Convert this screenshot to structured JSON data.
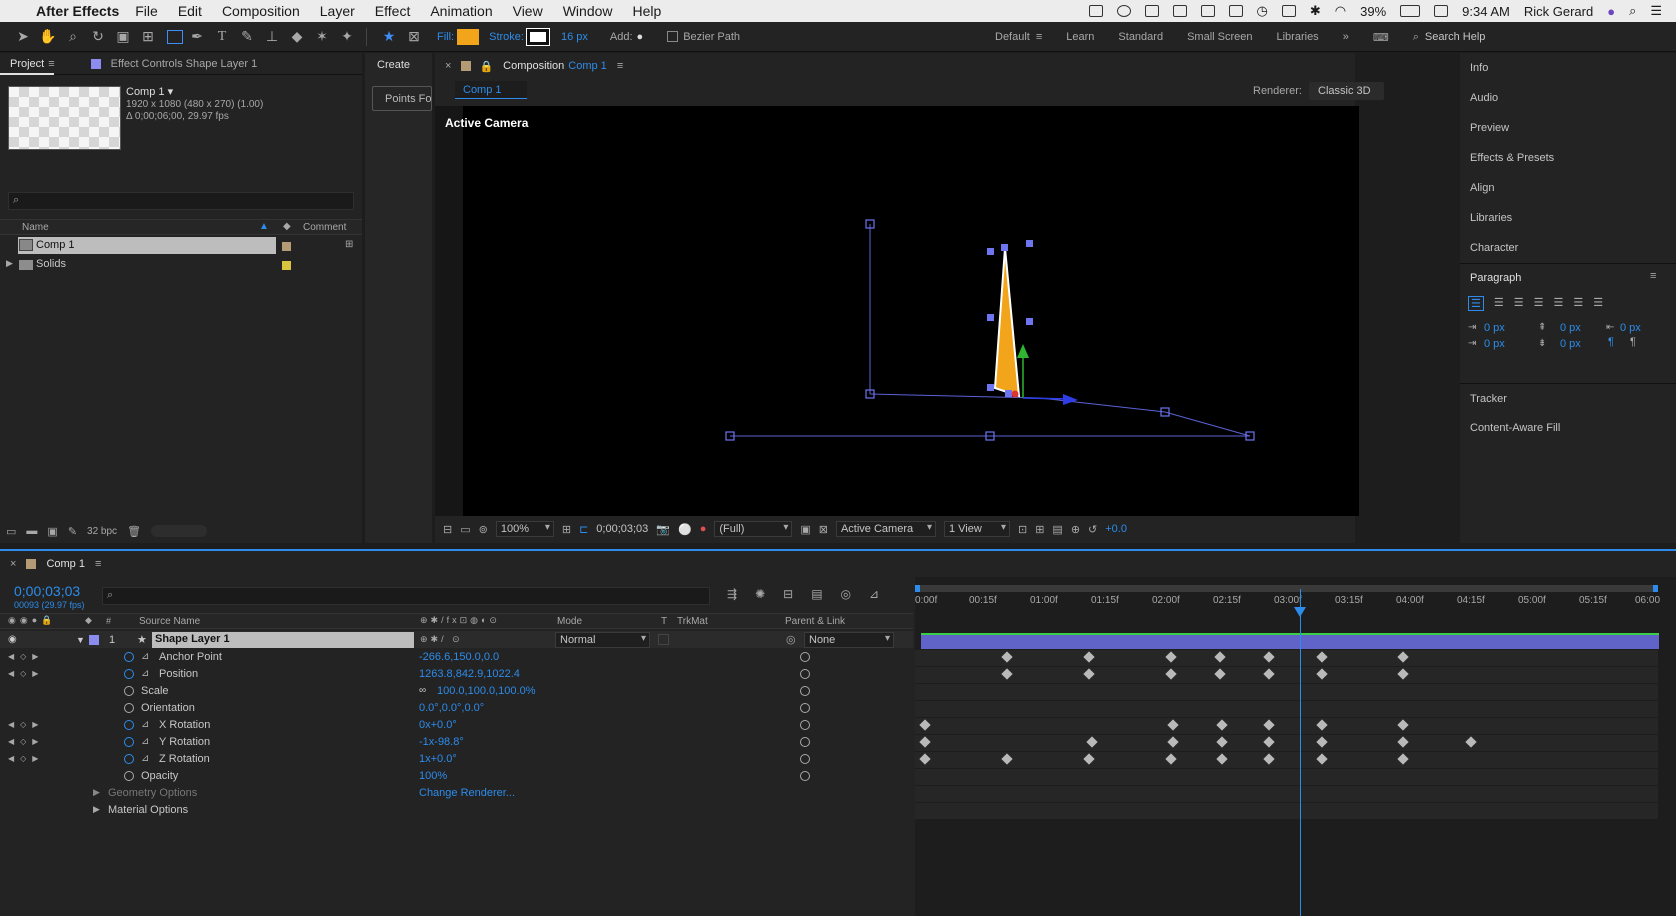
{
  "menubar": {
    "app": "After Effects",
    "menus": [
      "File",
      "Edit",
      "Composition",
      "Layer",
      "Effect",
      "Animation",
      "View",
      "Window",
      "Help"
    ],
    "battery": "39%",
    "time": "9:34 AM",
    "user": "Rick Gerard"
  },
  "toolbar": {
    "fill_label": "Fill:",
    "stroke_label": "Stroke:",
    "stroke_width": "16 px",
    "add_label": "Add:",
    "bezier_label": "Bezier Path",
    "workspaces": [
      "Default",
      "Learn",
      "Standard",
      "Small Screen",
      "Libraries"
    ],
    "active_workspace": "Default",
    "search_placeholder": "Search Help",
    "fill_color": "#f2a51a"
  },
  "project": {
    "tab_project": "Project",
    "tab_effect_controls": "Effect Controls Shape Layer 1",
    "comp_name": "Comp 1 ▾",
    "comp_dims": "1920 x 1080  (480 x 270) (1.00)",
    "comp_duration": "Δ 0;00;06;00, 29.97 fps",
    "col_name": "Name",
    "col_comment": "Comment",
    "items": [
      {
        "name": "Comp 1",
        "color": "#b49b76"
      },
      {
        "name": "Solids",
        "color": "#d8c43e"
      }
    ],
    "bpc": "32 bpc"
  },
  "create_panel": {
    "title": "Create",
    "button": "Points Fo"
  },
  "composition": {
    "title": "Composition",
    "comp": "Comp 1",
    "sub_tab": "Comp 1",
    "renderer_label": "Renderer:",
    "renderer": "Classic 3D",
    "camera_label": "Active Camera",
    "zoom": "100%",
    "timecode": "0;00;03;03",
    "resolution": "(Full)",
    "camera": "Active Camera",
    "views": "1 View",
    "exposure": "+0.0"
  },
  "right_panel": {
    "items": [
      "Info",
      "Audio",
      "Preview",
      "Effects & Presets",
      "Align",
      "Libraries",
      "Character"
    ],
    "paragraph_title": "Paragraph",
    "indent_values": [
      "0 px",
      "0 px",
      "0 px",
      "0 px",
      "0 px"
    ],
    "bottom_items": [
      "Tracker",
      "Content-Aware Fill"
    ]
  },
  "timeline": {
    "tab": "Comp 1",
    "timecode": "0;00;03;03",
    "frames": "00093 (29.97 fps)",
    "col_source": "Source Name",
    "col_mode": "Mode",
    "col_t": "T",
    "col_trkmat": "TrkMat",
    "col_parent": "Parent & Link",
    "layer_num": "1",
    "layer_name": "Shape Layer 1",
    "mode": "Normal",
    "parent": "None",
    "ruler": [
      "0:00f",
      "00:15f",
      "01:00f",
      "01:15f",
      "02:00f",
      "02:15f",
      "03:00f",
      "03:15f",
      "04:00f",
      "04:15f",
      "05:00f",
      "05:15f",
      "06:00"
    ],
    "properties": [
      {
        "name": "Anchor Point",
        "value": "-266.6,150.0,0.0",
        "animated": true
      },
      {
        "name": "Position",
        "value": "1263.8,842.9,1022.4",
        "animated": true
      },
      {
        "name": "Scale",
        "value": "100.0,100.0,100.0%",
        "animated": false
      },
      {
        "name": "Orientation",
        "value": "0.0°,0.0°,0.0°",
        "animated": false
      },
      {
        "name": "X Rotation",
        "value": "0x+0.0°",
        "animated": true
      },
      {
        "name": "Y Rotation",
        "value": "-1x-98.8°",
        "animated": true
      },
      {
        "name": "Z Rotation",
        "value": "1x+0.0°",
        "animated": true
      },
      {
        "name": "Opacity",
        "value": "100%",
        "animated": false
      }
    ],
    "groups": [
      {
        "name": "Geometry Options",
        "value": "Change Renderer..."
      },
      {
        "name": "Material Options",
        "value": ""
      }
    ]
  }
}
